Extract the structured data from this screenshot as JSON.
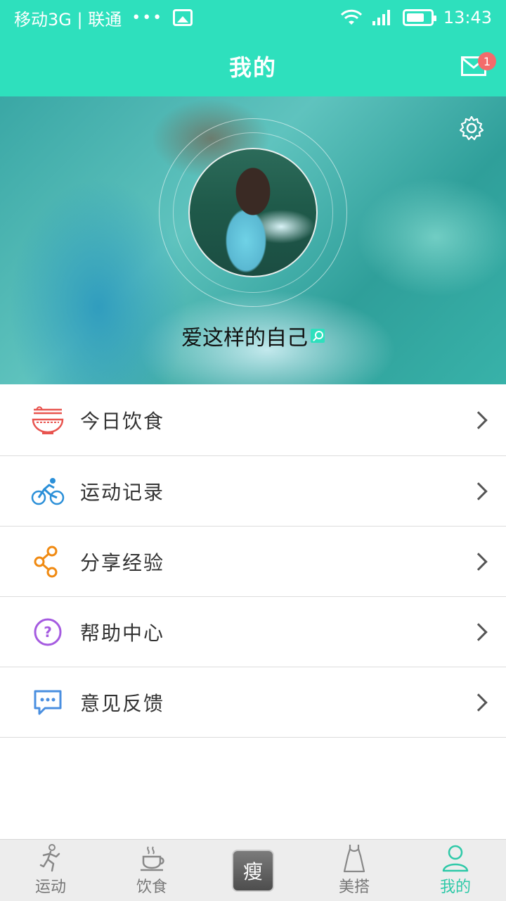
{
  "status_bar": {
    "carrier": "移动3G | 联通",
    "dots": "•••",
    "time": "13:43"
  },
  "header": {
    "title": "我的",
    "mail_badge": "1"
  },
  "profile": {
    "nickname": "爱这样的自己"
  },
  "menu": {
    "items": [
      {
        "label": "今日饮食",
        "icon": "noodle-bowl-icon",
        "color": "#e8544f"
      },
      {
        "label": "运动记录",
        "icon": "bicycle-icon",
        "color": "#2a8fd8"
      },
      {
        "label": "分享经验",
        "icon": "share-icon",
        "color": "#f08a12"
      },
      {
        "label": "帮助中心",
        "icon": "help-icon",
        "color": "#a55be0"
      },
      {
        "label": "意见反馈",
        "icon": "feedback-icon",
        "color": "#4a8fe0"
      }
    ]
  },
  "tabs": [
    {
      "label": "运动",
      "icon": "runner-icon",
      "active": false
    },
    {
      "label": "饮食",
      "icon": "coffee-cup-icon",
      "active": false
    },
    {
      "label": "瘦",
      "icon": "app-logo",
      "active": false
    },
    {
      "label": "美搭",
      "icon": "dress-icon",
      "active": false
    },
    {
      "label": "我的",
      "icon": "person-icon",
      "active": true
    }
  ],
  "colors": {
    "accent": "#2ee0bd",
    "badge": "#f36b6b",
    "active_tab": "#2ec9a8"
  }
}
